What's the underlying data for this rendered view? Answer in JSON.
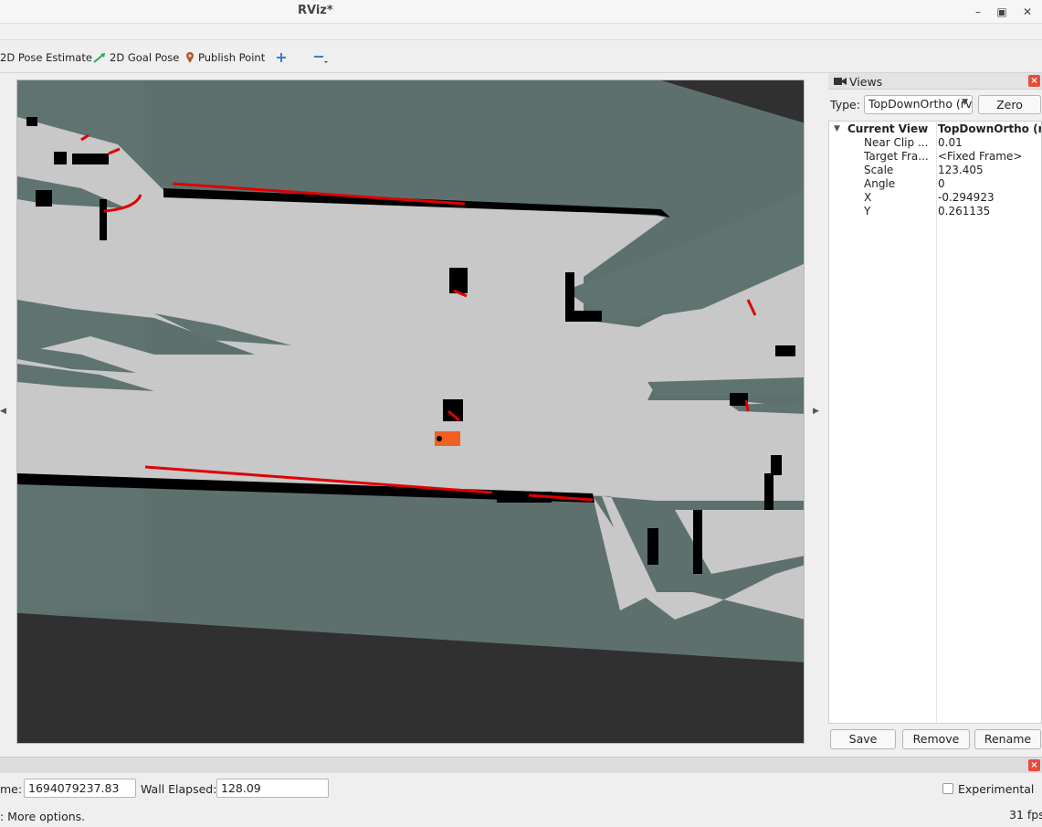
{
  "window": {
    "title": "RViz*",
    "controls": [
      "minimize-icon",
      "maximize-icon",
      "close-icon"
    ]
  },
  "toolbar": {
    "pose_estimate_label": "2D Pose Estimate",
    "goal_pose_label": "2D Goal Pose",
    "publish_point_label": "Publish Point",
    "add_tool_icon": "plus-icon",
    "remove_tool_icon": "minus-icon"
  },
  "views_panel": {
    "title": "Views",
    "type_label": "Type:",
    "type_value": "TopDownOrtho (rviz_defa",
    "zero_label": "Zero",
    "current_view": {
      "label": "Current View",
      "value": "TopDownOrtho (rviz_default_plugins)"
    },
    "properties": [
      {
        "name": "Near Clip ...",
        "value": "0.01"
      },
      {
        "name": "Target Fra...",
        "value": "<Fixed Frame>"
      },
      {
        "name": "Scale",
        "value": "123.405"
      },
      {
        "name": "Angle",
        "value": "0"
      },
      {
        "name": "X",
        "value": "-0.294923"
      },
      {
        "name": "Y",
        "value": "0.261135"
      }
    ],
    "save_label": "Save",
    "remove_label": "Remove",
    "rename_label": "Rename"
  },
  "time_panel": {
    "ros_time_label": "me:",
    "ros_time_value": "1694079237.83",
    "wall_elapsed_label": "Wall Elapsed:",
    "wall_elapsed_value": "128.09",
    "experimental_label": "Experimental",
    "hint": ": More options.",
    "fps": "31 fps"
  },
  "colors": {
    "map_free": "#c8c8c8",
    "map_unknown": "#5f7371",
    "map_occupied": "#000000",
    "laser_scan": "#e00000",
    "robot": "#f06020",
    "background": "#303030"
  }
}
